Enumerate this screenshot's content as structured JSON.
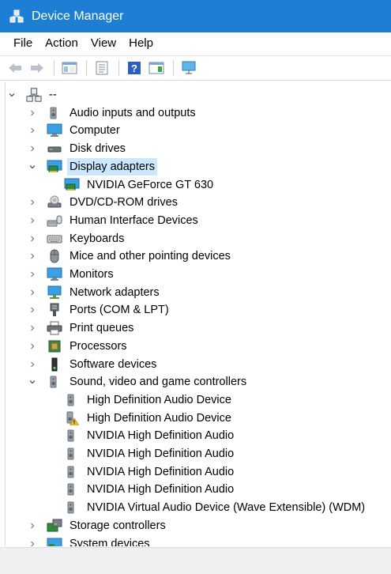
{
  "window": {
    "title": "Device Manager"
  },
  "menu": [
    "File",
    "Action",
    "View",
    "Help"
  ],
  "toolbar_icons": [
    "back-arrow-icon",
    "forward-arrow-icon",
    "show-hide-tree-icon",
    "properties-icon",
    "help-icon",
    "action-pane-icon",
    "scan-hardware-icon"
  ],
  "tree": {
    "root": "--",
    "items": [
      {
        "label": "Audio inputs and outputs",
        "icon": "speaker-icon",
        "expanded": false
      },
      {
        "label": "Computer",
        "icon": "monitor-icon",
        "expanded": false
      },
      {
        "label": "Disk drives",
        "icon": "disk-drive-icon",
        "expanded": false
      },
      {
        "label": "Display adapters",
        "icon": "display-adapter-icon",
        "expanded": true,
        "selected": true,
        "children": [
          {
            "label": "NVIDIA GeForce GT 630",
            "icon": "display-adapter-icon"
          }
        ]
      },
      {
        "label": "DVD/CD-ROM drives",
        "icon": "dvd-drive-icon",
        "expanded": false
      },
      {
        "label": "Human Interface Devices",
        "icon": "hid-icon",
        "expanded": false
      },
      {
        "label": "Keyboards",
        "icon": "keyboard-icon",
        "expanded": false
      },
      {
        "label": "Mice and other pointing devices",
        "icon": "mouse-icon",
        "expanded": false
      },
      {
        "label": "Monitors",
        "icon": "monitor-icon",
        "expanded": false
      },
      {
        "label": "Network adapters",
        "icon": "network-adapter-icon",
        "expanded": false
      },
      {
        "label": "Ports (COM & LPT)",
        "icon": "port-icon",
        "expanded": false
      },
      {
        "label": "Print queues",
        "icon": "printer-icon",
        "expanded": false
      },
      {
        "label": "Processors",
        "icon": "processor-icon",
        "expanded": false
      },
      {
        "label": "Software devices",
        "icon": "software-device-icon",
        "expanded": false
      },
      {
        "label": "Sound, video and game controllers",
        "icon": "speaker-icon",
        "expanded": true,
        "children": [
          {
            "label": "High Definition Audio Device",
            "icon": "speaker-icon"
          },
          {
            "label": "High Definition Audio Device",
            "icon": "speaker-warning-icon"
          },
          {
            "label": "NVIDIA High Definition Audio",
            "icon": "speaker-icon"
          },
          {
            "label": "NVIDIA High Definition Audio",
            "icon": "speaker-icon"
          },
          {
            "label": "NVIDIA High Definition Audio",
            "icon": "speaker-icon"
          },
          {
            "label": "NVIDIA High Definition Audio",
            "icon": "speaker-icon"
          },
          {
            "label": "NVIDIA Virtual Audio Device (Wave Extensible) (WDM)",
            "icon": "speaker-icon"
          }
        ]
      },
      {
        "label": "Storage controllers",
        "icon": "storage-controller-icon",
        "expanded": false
      },
      {
        "label": "System devices",
        "icon": "system-device-icon",
        "expanded": false
      }
    ]
  },
  "colors": {
    "titlebar": "#1c7fd3",
    "selection": "#cce8ff"
  }
}
